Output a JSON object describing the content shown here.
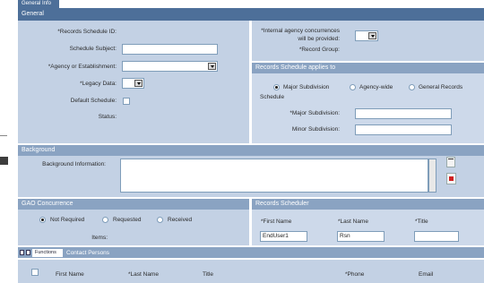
{
  "tab": {
    "label": "General Info"
  },
  "general": {
    "title": "General",
    "records_schedule_id_label": "*Records Schedule ID:",
    "schedule_subject_label": "Schedule Subject:",
    "agency_label": "*Agency or Establishment:",
    "legacy_data_label": "*Legacy Data:",
    "default_schedule_label": "Default Schedule:",
    "status_label": "Status:",
    "concurrences_label_1": "*Internal agency concurrences",
    "concurrences_label_2": "will be provided:",
    "record_group_label": "*Record Group:"
  },
  "applies": {
    "title": "Records Schedule applies to",
    "options": [
      "Major Subdivision",
      "Agency-wide",
      "General Records"
    ],
    "option_cont": "Schedule",
    "major_subdivision_label": "*Major Subdivision:",
    "minor_subdivision_label": "Minor Subdivision:"
  },
  "background": {
    "title": "Background",
    "info_label": "Background Information:"
  },
  "gao": {
    "title": "GAO Concurrence",
    "options": [
      "Not Required",
      "Requested",
      "Received"
    ],
    "items_label": "Items:"
  },
  "scheduler": {
    "title": "Records Scheduler",
    "first_name_label": "*First Name",
    "last_name_label": "*Last Name",
    "title_label": "*Title",
    "first_name_value": "EndUser1",
    "last_name_value": "Rsn",
    "title_value": ""
  },
  "contacts": {
    "functions_label": "Functions",
    "title": "Contact Persons",
    "columns": [
      "First Name",
      "*Last Name",
      "Title",
      "*Phone",
      "Email"
    ]
  }
}
